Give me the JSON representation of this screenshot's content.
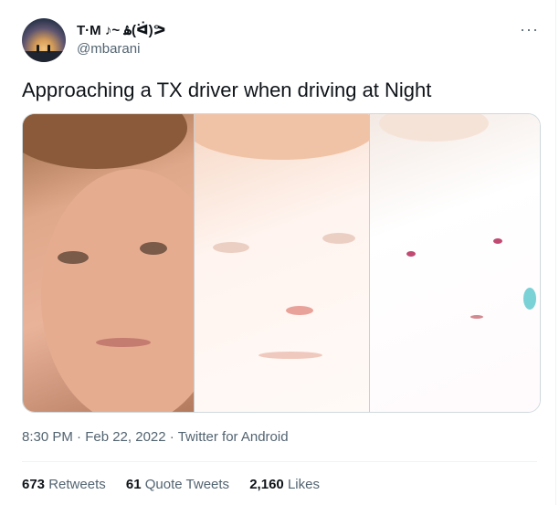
{
  "author": {
    "display_name": "T·M ♪~ ۿ(ᐛ)ᕗ",
    "handle": "@mbarani",
    "avatar_icon": "sunset-couple-avatar"
  },
  "tweet": {
    "text": "Approaching a TX driver when driving at Night",
    "more_icon": "···",
    "timestamp": "8:30 PM · Feb 22, 2022",
    "source": "Twitter for Android"
  },
  "stats": {
    "retweets_count": "673",
    "retweets_label": "Retweets",
    "quote_count": "61",
    "quote_label": "Quote Tweets",
    "likes_count": "2,160",
    "likes_label": "Likes"
  }
}
